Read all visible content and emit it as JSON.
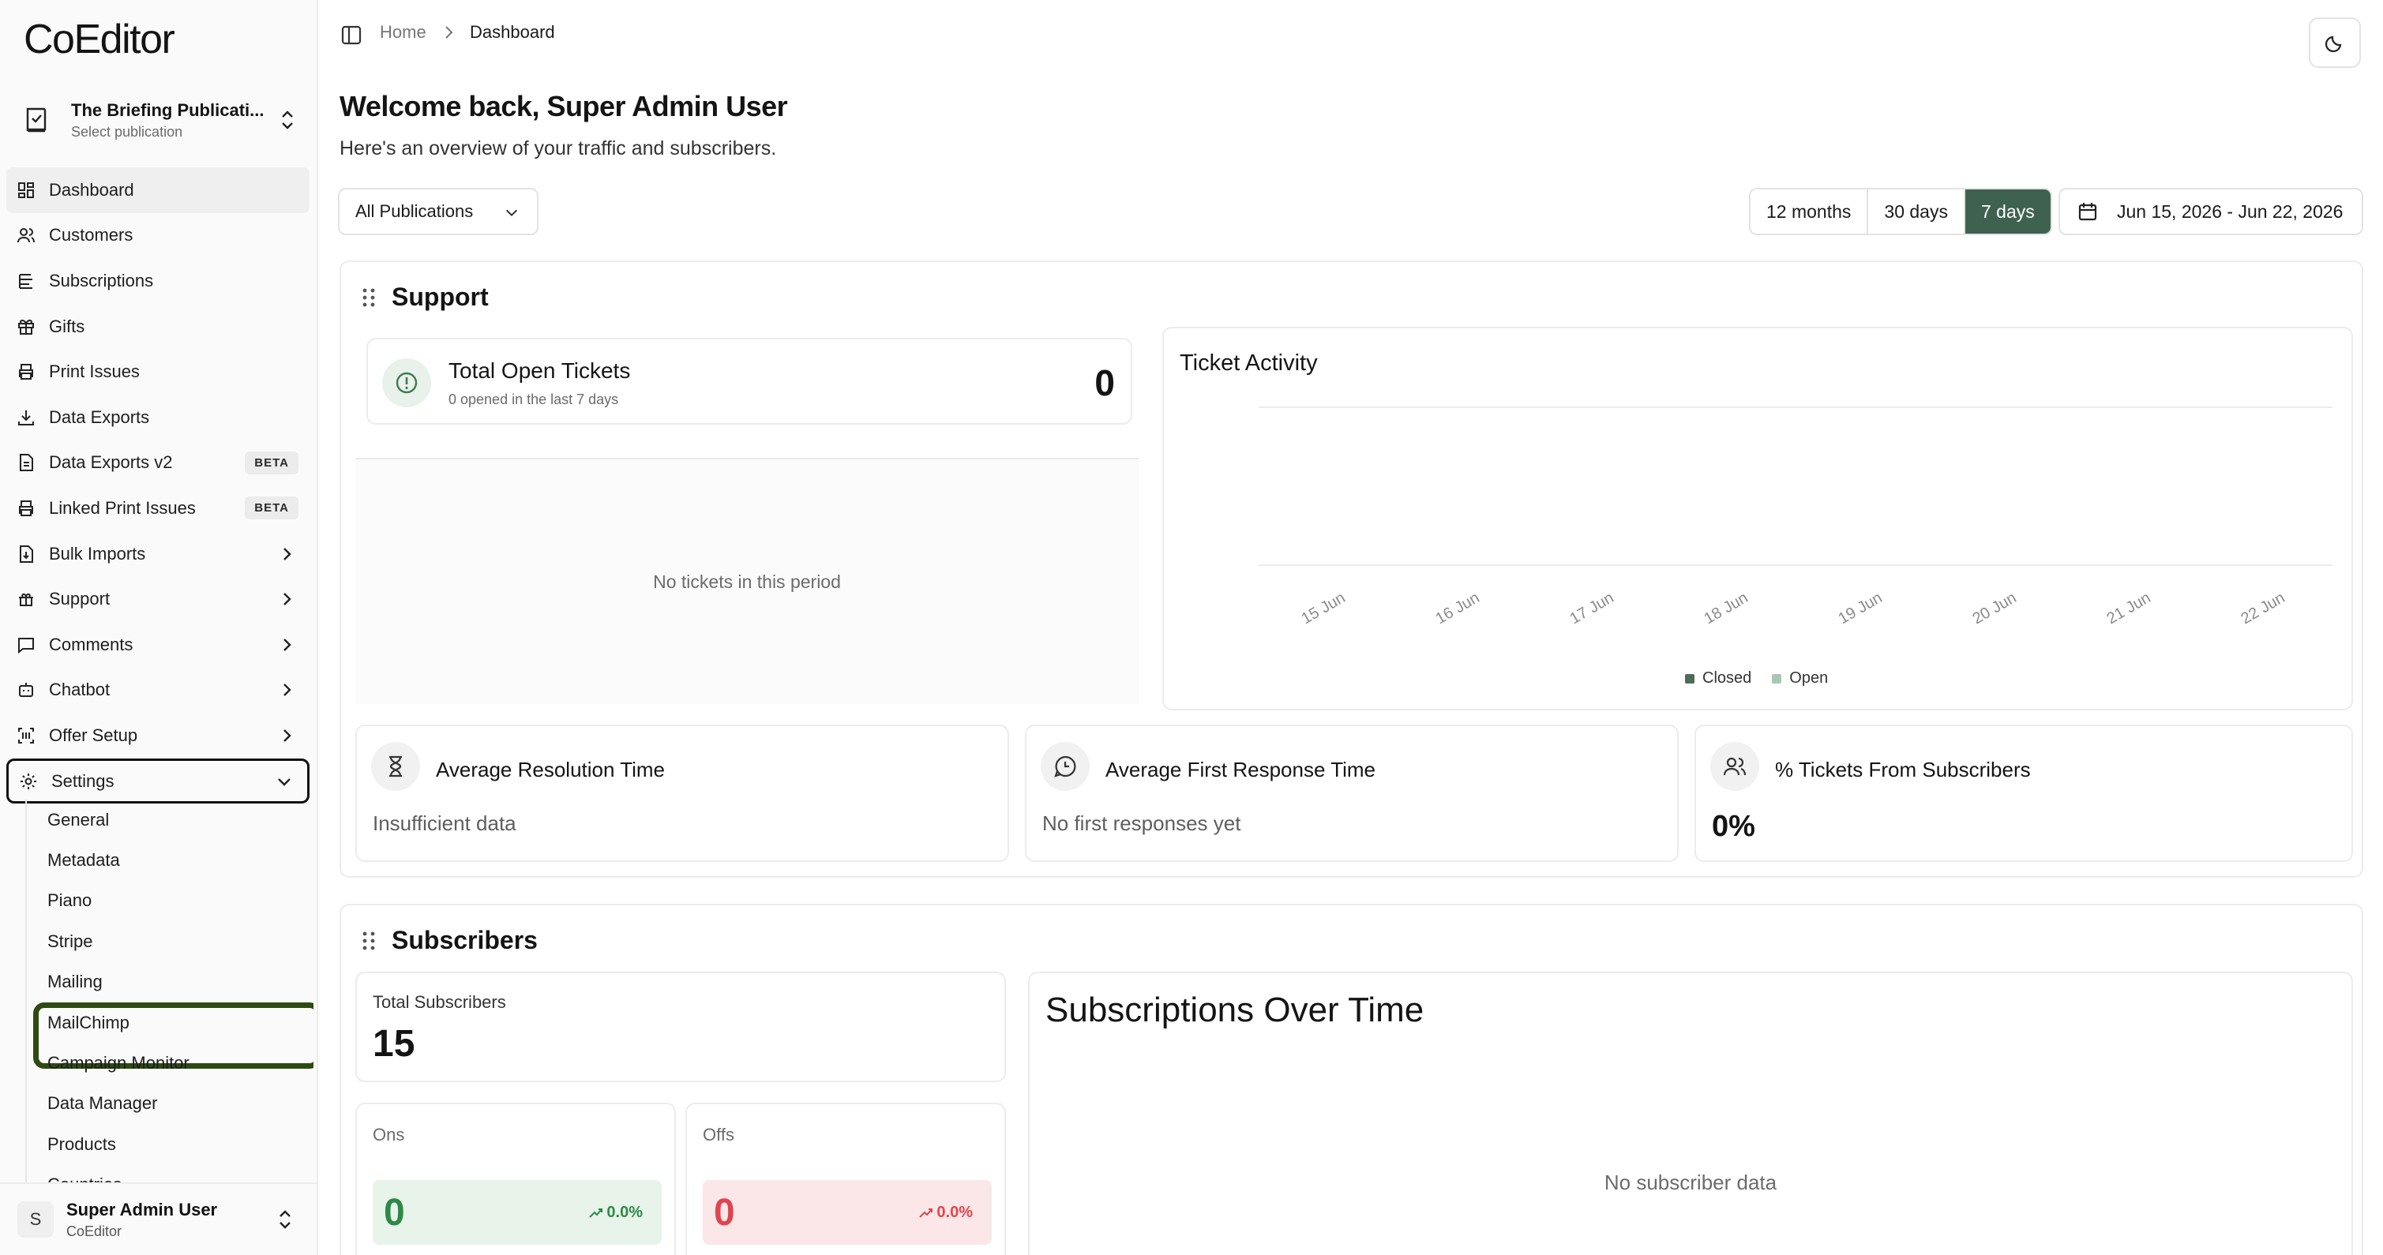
{
  "app": {
    "name": "CoEditor"
  },
  "publication": {
    "name": "The Briefing Publicati...",
    "hint": "Select publication"
  },
  "sidebar": {
    "items": [
      {
        "label": "Dashboard",
        "icon": "dashboard-icon"
      },
      {
        "label": "Customers",
        "icon": "users-icon"
      },
      {
        "label": "Subscriptions",
        "icon": "list-icon"
      },
      {
        "label": "Gifts",
        "icon": "gift-icon"
      },
      {
        "label": "Print Issues",
        "icon": "printer-icon"
      },
      {
        "label": "Data Exports",
        "icon": "download-icon"
      },
      {
        "label": "Data Exports v2",
        "icon": "file-icon",
        "badge": "BETA"
      },
      {
        "label": "Linked Print Issues",
        "icon": "printer-icon",
        "badge": "BETA"
      },
      {
        "label": "Bulk Imports",
        "icon": "file-import-icon"
      },
      {
        "label": "Support",
        "icon": "support-icon"
      },
      {
        "label": "Comments",
        "icon": "comment-icon"
      },
      {
        "label": "Chatbot",
        "icon": "bot-icon"
      },
      {
        "label": "Offer Setup",
        "icon": "offer-icon"
      },
      {
        "label": "Settings",
        "icon": "gear-icon"
      }
    ],
    "settings_sub": [
      "General",
      "Metadata",
      "Piano",
      "Stripe",
      "Mailing",
      "MailChimp",
      "Campaign Monitor",
      "Data Manager",
      "Products",
      "Countries"
    ]
  },
  "user": {
    "initial": "S",
    "name": "Super Admin User",
    "org": "CoEditor"
  },
  "breadcrumb": {
    "home": "Home",
    "current": "Dashboard"
  },
  "header": {
    "welcome": "Welcome back, Super Admin User",
    "subtitle": "Here's an overview of your traffic and subscribers."
  },
  "filters": {
    "publication": "All Publications",
    "ranges": [
      "12 months",
      "30 days",
      "7 days"
    ],
    "active_range": "7 days",
    "date_range": "Jun 15, 2026 - Jun 22, 2026"
  },
  "support": {
    "title": "Support",
    "open_tickets": {
      "title": "Total Open Tickets",
      "sub": "0 opened in the last 7 days",
      "value": "0"
    },
    "empty": "No tickets in this period",
    "activity": {
      "title": "Ticket Activity",
      "legend": [
        "Closed",
        "Open"
      ]
    },
    "metrics": [
      {
        "title": "Average Resolution Time",
        "value": "Insufficient data",
        "icon": "hourglass-icon"
      },
      {
        "title": "Average First Response Time",
        "value": "No first responses yet",
        "icon": "message-clock-icon"
      },
      {
        "title": "% Tickets From Subscribers",
        "value": "0%",
        "icon": "users-icon"
      }
    ]
  },
  "subscribers": {
    "title": "Subscribers",
    "total_label": "Total Subscribers",
    "total": "15",
    "ons": {
      "label": "Ons",
      "value": "0",
      "pct": "0.0%"
    },
    "offs": {
      "label": "Offs",
      "value": "0",
      "pct": "0.0%"
    },
    "over_time": {
      "title": "Subscriptions Over Time",
      "empty": "No subscriber data"
    }
  },
  "colors": {
    "accent": "#3f6250",
    "ons": "#2c8a47",
    "offs": "#e0454f",
    "closed": "#4f6b5a",
    "open": "#a9c8b3"
  },
  "chart_data": {
    "type": "bar",
    "title": "Ticket Activity",
    "categories": [
      "15 Jun",
      "16 Jun",
      "17 Jun",
      "18 Jun",
      "19 Jun",
      "20 Jun",
      "21 Jun",
      "22 Jun"
    ],
    "series": [
      {
        "name": "Closed",
        "values": [
          0,
          0,
          0,
          0,
          0,
          0,
          0,
          0
        ]
      },
      {
        "name": "Open",
        "values": [
          0,
          0,
          0,
          0,
          0,
          0,
          0,
          0
        ]
      }
    ],
    "grid": true,
    "legend": "bottom"
  }
}
